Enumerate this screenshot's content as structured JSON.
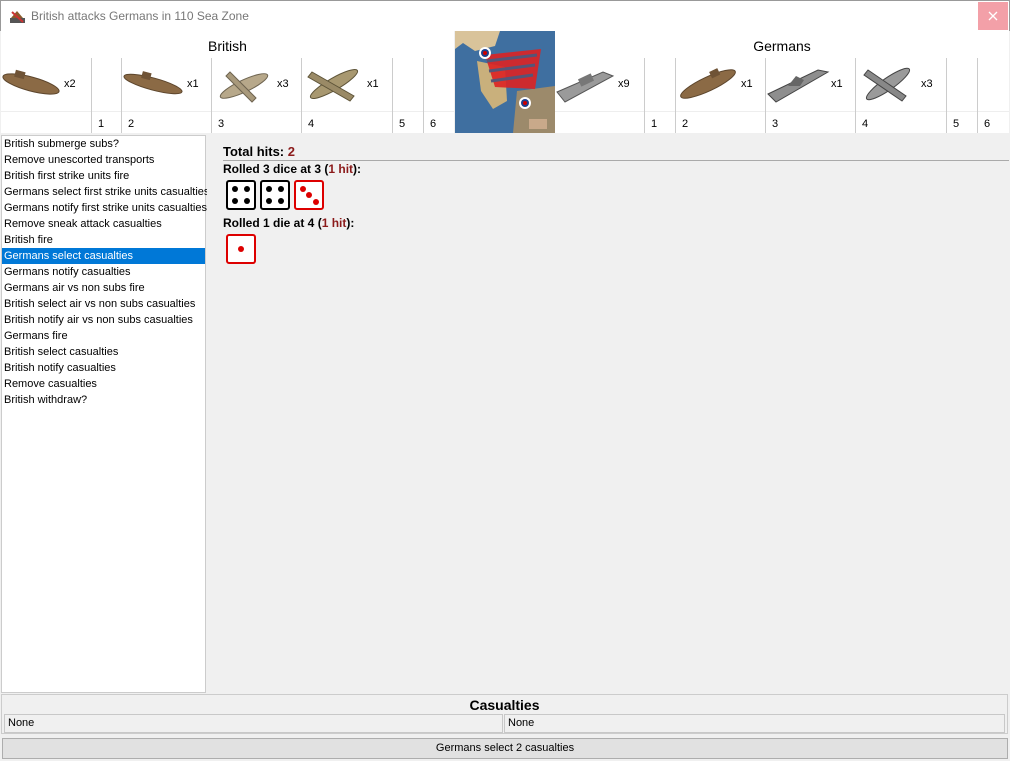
{
  "window": {
    "title": "British attacks Germans in 110 Sea Zone",
    "close_icon": "close-icon"
  },
  "attacker": {
    "name": "British",
    "column_numbers": [
      "1",
      "2",
      "3",
      "4",
      "5",
      "6"
    ],
    "units": [
      {
        "icon": "submarine-icon",
        "count": "x2"
      },
      {
        "icon": "submarine-icon",
        "count": "x1"
      },
      {
        "icon": "fighter-icon",
        "count": "x3"
      },
      {
        "icon": "bomber-icon",
        "count": "x1"
      }
    ]
  },
  "defender": {
    "name": "Germans",
    "column_numbers": [
      "1",
      "2",
      "3",
      "4",
      "5",
      "6"
    ],
    "units": [
      {
        "icon": "transport-icon",
        "count": "x9"
      },
      {
        "icon": "submarine-icon",
        "count": "x1"
      },
      {
        "icon": "destroyer-icon",
        "count": "x1"
      },
      {
        "icon": "fighter-icon",
        "count": "x3"
      }
    ]
  },
  "territory_icon": "sea-zone-map-icon",
  "steps": [
    "British submerge subs?",
    "Remove unescorted transports",
    "British first strike units fire",
    "Germans select first strike units casualties",
    "Germans notify first strike units casualties",
    "Remove sneak attack casualties",
    "British fire",
    "Germans select casualties",
    "Germans notify casualties",
    "Germans air vs non subs fire",
    "British select air vs non subs casualties",
    "British notify air vs non subs casualties",
    "Germans fire",
    "British select casualties",
    "British notify casualties",
    "Remove casualties",
    "British withdraw?"
  ],
  "selected_step": 7,
  "dice": {
    "total_label": "Total hits:",
    "total_value": "2",
    "rolls": [
      {
        "label_prefix": "Rolled 3 dice at 3 (",
        "hit_text": "1 hit",
        "label_suffix": "):",
        "dice": [
          4,
          4,
          3
        ],
        "hits": [
          false,
          false,
          true
        ]
      },
      {
        "label_prefix": "Rolled 1 die at 4 (",
        "hit_text": "1 hit",
        "label_suffix": "):",
        "dice": [
          1
        ],
        "hits": [
          true
        ]
      }
    ]
  },
  "casualties": {
    "title": "Casualties",
    "left": "None",
    "right": "None"
  },
  "action_button": "Germans select 2 casualties",
  "colors": {
    "selection": "#0078d7",
    "hit": "#d00000",
    "hit_text": "#8b1a1a",
    "close_hover": "#f3a0a8"
  }
}
